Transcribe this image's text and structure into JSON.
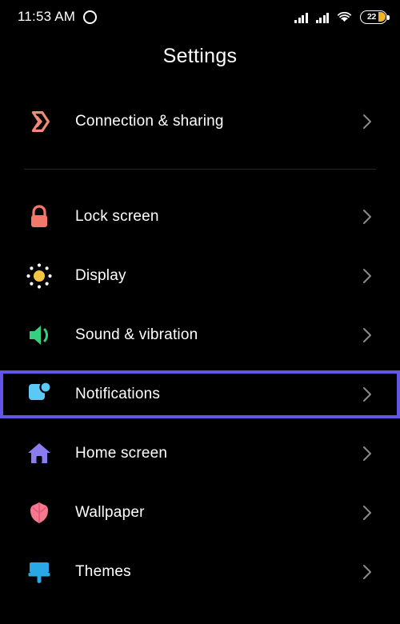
{
  "status_bar": {
    "time": "11:53 AM",
    "camera_icon": "camera-punch-hole-icon",
    "signal_1_icon": "cellular-signal-icon",
    "signal_2_icon": "cellular-signal-icon",
    "wifi_icon": "wifi-icon",
    "battery_icon": "battery-icon",
    "battery_level": "22"
  },
  "header": {
    "title": "Settings"
  },
  "colors": {
    "background": "#000000",
    "text": "#ffffff",
    "chevron": "#8a8a8a",
    "divider": "#252525",
    "highlight": "#6355E8",
    "battery_fill": "#F0B429",
    "icon_connection": "#F08A7A",
    "icon_lock": "#F4786A",
    "icon_display": "#F5C542",
    "icon_sound": "#34D07F",
    "icon_notifications": "#5BC8F5",
    "icon_home": "#8A7DF0",
    "icon_wallpaper": "#F5788F",
    "icon_themes": "#29A8E8"
  },
  "list": {
    "group_one": [
      {
        "label": "Connection & sharing",
        "icon": "connection-sharing-icon",
        "chevron": "chevron-right-icon",
        "selected": false
      }
    ],
    "group_two": [
      {
        "label": "Lock screen",
        "icon": "lock-icon",
        "chevron": "chevron-right-icon",
        "selected": false
      },
      {
        "label": "Display",
        "icon": "display-brightness-icon",
        "chevron": "chevron-right-icon",
        "selected": false
      },
      {
        "label": "Sound & vibration",
        "icon": "sound-speaker-icon",
        "chevron": "chevron-right-icon",
        "selected": false
      },
      {
        "label": "Notifications",
        "icon": "notifications-badge-icon",
        "chevron": "chevron-right-icon",
        "selected": true
      },
      {
        "label": "Home screen",
        "icon": "home-icon",
        "chevron": "chevron-right-icon",
        "selected": false
      },
      {
        "label": "Wallpaper",
        "icon": "wallpaper-flower-icon",
        "chevron": "chevron-right-icon",
        "selected": false
      },
      {
        "label": "Themes",
        "icon": "themes-brush-icon",
        "chevron": "chevron-right-icon",
        "selected": false
      }
    ]
  }
}
